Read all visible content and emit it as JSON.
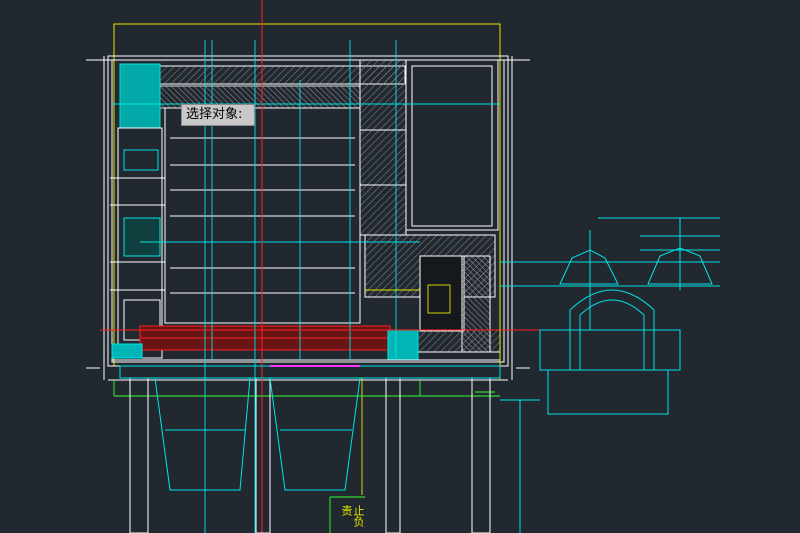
{
  "prompt": {
    "text": "选择对象:"
  },
  "vertical_label": {
    "text": "止负责"
  },
  "colors": {
    "background": "#212830",
    "white": "#ffffff",
    "yellow": "#e6e600",
    "cyan": "#00e5e5",
    "cyan_fill": "#00b5b5",
    "red": "#ff2020",
    "green": "#33ff33",
    "magenta": "#ff33ff",
    "hatch": "#9a9a9a",
    "blue": "#3366ff"
  },
  "icons": [
    "dimension-marker-icon",
    "level-marker-icon"
  ]
}
